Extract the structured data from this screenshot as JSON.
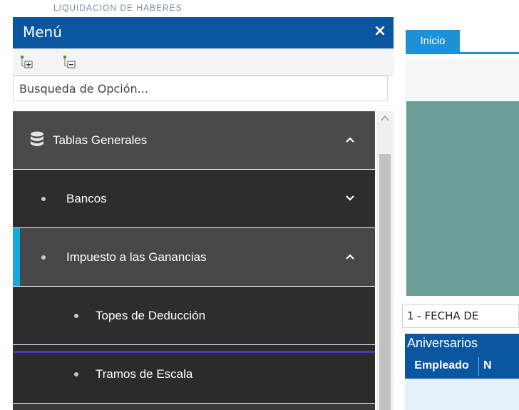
{
  "app": {
    "title": "LIQUIDACION DE HABERES"
  },
  "sidebar": {
    "title": "Menú",
    "close_symbol": "×",
    "search_placeholder": "Busqueda de Opción...",
    "tools": [
      {
        "icon": "expand-tree-icon"
      },
      {
        "icon": "collapse-tree-icon"
      }
    ],
    "items": [
      {
        "label": "Tablas Generales",
        "level": 0,
        "icon": "database-icon",
        "chevron": "up"
      },
      {
        "label": "Bancos",
        "level": 1,
        "chevron": "down"
      },
      {
        "label": "Impuesto a las Ganancias",
        "level": 1,
        "chevron": "up",
        "active": true
      },
      {
        "label": "Topes de Deducción",
        "level": 2
      },
      {
        "label": "Tramos de Escala",
        "level": 2,
        "highlighted": true
      }
    ]
  },
  "main": {
    "tab": "Inicio",
    "select_value": "1 - FECHA DE",
    "grid": {
      "title": "Aniversarios",
      "columns": [
        "Empleado",
        "N"
      ]
    }
  },
  "colors": {
    "menu_header": "#0b56a0",
    "active_indicator": "#15a8e1",
    "tab": "#1e90d6",
    "teal_panel": "#6a9e96",
    "highlight_frame": "#3d3dcc"
  }
}
